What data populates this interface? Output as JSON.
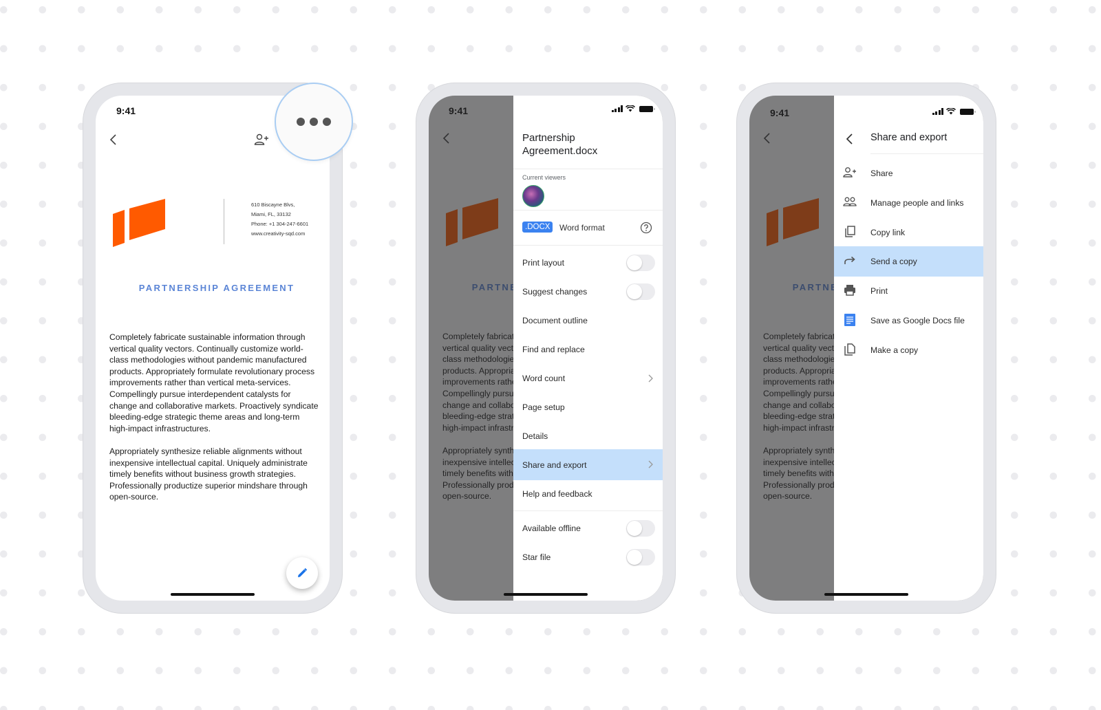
{
  "status_bar": {
    "time": "9:41"
  },
  "document": {
    "address_lines": [
      "610 Biscayne Blvs,",
      "Miami, FL, 33132",
      "Phone: +1 304-247-6601",
      "www.creativity-sqd.com"
    ],
    "title": "PARTNERSHIP AGREEMENT",
    "paragraph_1": "Completely fabricate sustainable information through vertical quality vectors. Continually customize world-class methodologies without pandemic manufactured products. Appropriately formulate revolutionary process improvements rather than vertical meta-services. Compellingly pursue interdependent catalysts for change and collaborative markets. Proactively syndicate bleeding-edge strategic theme areas and long-term high-impact infrastructures.",
    "paragraph_2": "Appropriately synthesize reliable alignments without inexpensive intellectual capital. Uniquely administrate timely benefits without business growth strategies. Professionally productize superior mindshare through open-source.",
    "brand_color": "#ff5a00",
    "dim_brand_color": "#8a3a18",
    "title_color": "#5b85d6"
  },
  "icons": {
    "back": "chevron-left-icon",
    "add_person": "person-add-icon",
    "more": "more-horizontal-icon",
    "edit": "pencil-icon",
    "help": "help-circle-icon"
  },
  "menu": {
    "file_name_line1": "Partnership",
    "file_name_line2": "Agreement.docx",
    "current_viewers_label": "Current viewers",
    "format_badge": ".DOCX",
    "format_label": "Word format",
    "items": [
      {
        "label": "Print layout",
        "toggle": false
      },
      {
        "label": "Suggest changes",
        "toggle": false
      },
      {
        "label": "Document outline"
      },
      {
        "label": "Find and replace"
      },
      {
        "label": "Word count",
        "chevron": true
      },
      {
        "label": "Page setup"
      },
      {
        "label": "Details"
      },
      {
        "label": "Share and export",
        "chevron": true,
        "active": true
      },
      {
        "label": "Help and feedback"
      }
    ],
    "bottom_items": [
      {
        "label": "Available offline",
        "toggle": false
      },
      {
        "label": "Star file",
        "toggle": false
      }
    ],
    "highlight_color": "#c4dffb"
  },
  "share_export": {
    "title": "Share and export",
    "items": [
      {
        "label": "Share",
        "icon": "person-add-icon"
      },
      {
        "label": "Manage people and links",
        "icon": "people-icon"
      },
      {
        "label": "Copy link",
        "icon": "copy-icon"
      },
      {
        "label": "Send a copy",
        "icon": "forward-arrow-icon",
        "active": true
      },
      {
        "label": "Print",
        "icon": "printer-icon"
      },
      {
        "label": "Save as Google Docs file",
        "icon": "google-docs-icon"
      },
      {
        "label": "Make a copy",
        "icon": "file-copy-icon"
      }
    ]
  }
}
